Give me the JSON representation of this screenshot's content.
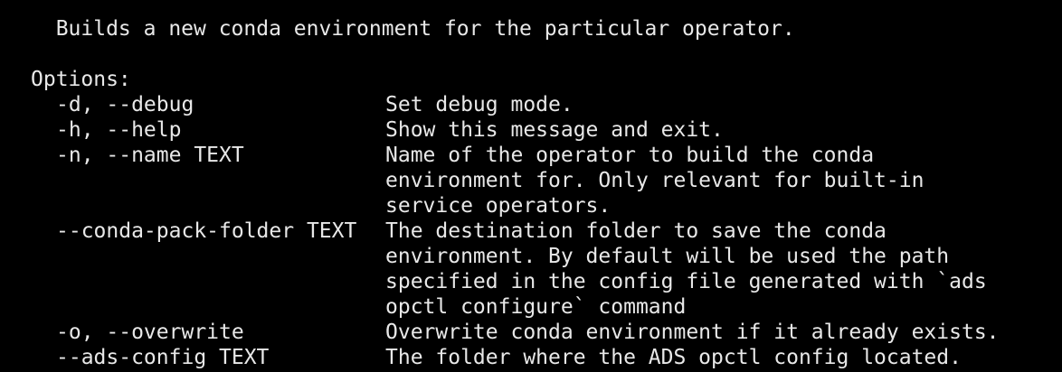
{
  "terminal": {
    "description": "  Builds a new conda environment for the particular operator.",
    "options_header": "Options:",
    "options": [
      {
        "flag": "-d, --debug",
        "help": [
          "Set debug mode."
        ]
      },
      {
        "flag": "-h, --help",
        "help": [
          "Show this message and exit."
        ]
      },
      {
        "flag": "-n, --name TEXT",
        "help": [
          "Name of the operator to build the conda",
          "environment for. Only relevant for built-in",
          "service operators."
        ]
      },
      {
        "flag": "--conda-pack-folder TEXT",
        "help": [
          "The destination folder to save the conda",
          "environment. By default will be used the path",
          "specified in the config file generated with `ads",
          "opctl configure` command"
        ]
      },
      {
        "flag": "-o, --overwrite",
        "help": [
          "Overwrite conda environment if it already exists."
        ]
      },
      {
        "flag": "--ads-config TEXT",
        "help": [
          "The folder where the ADS opctl config located."
        ]
      }
    ]
  }
}
